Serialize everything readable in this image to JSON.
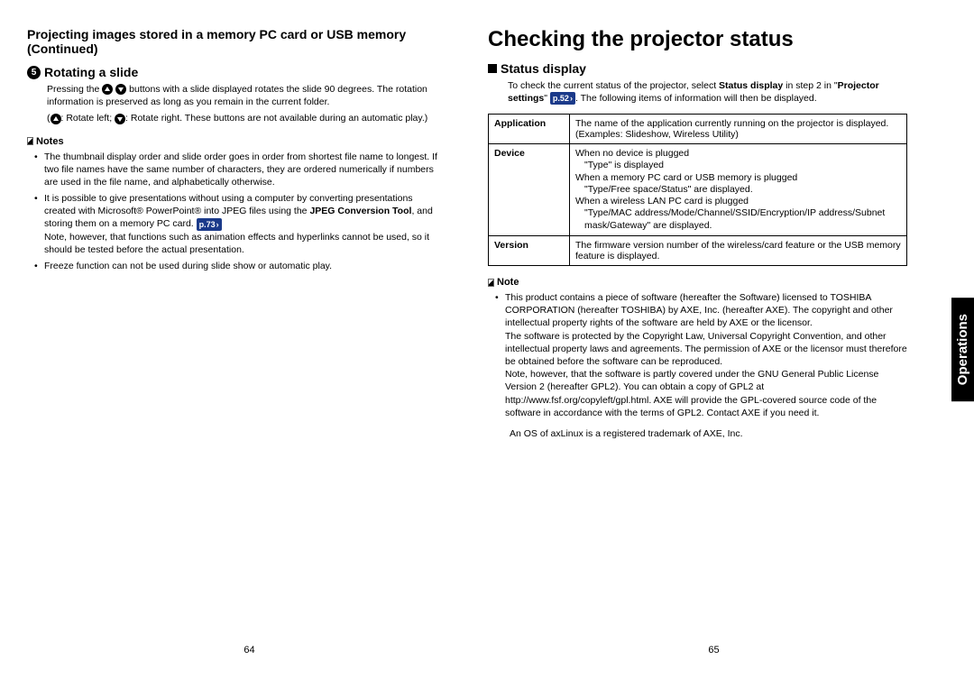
{
  "left": {
    "continued_header": "Projecting images stored in a memory PC card or USB memory (Continued)",
    "rotating": {
      "num": "5",
      "title": "Rotating a slide",
      "body1_a": "Pressing the ",
      "body1_b": " buttons with a slide displayed rotates the slide 90 degrees. The rotation information is preserved as long as you remain in the current folder.",
      "body2_a": ": Rotate left; ",
      "body2_b": ": Rotate right. These buttons are not available during an automatic play.)"
    },
    "notes_label": "Notes",
    "notes": [
      "The thumbnail display order and slide order goes in order from shortest file name to longest. If two file names have the same number of characters, they are ordered numerically if numbers are used in the file name, and alphabetically otherwise.",
      {
        "pre": "It is possible to give presentations without using a computer by converting presentations created with Microsoft® PowerPoint® into JPEG files using the ",
        "bold": "JPEG Conversion Tool",
        "post": ", and storing them on a memory PC card. ",
        "badge": "p.73",
        "tail": "\nNote, however, that functions such as animation effects and hyperlinks cannot be used, so it should be tested before the actual presentation."
      },
      "Freeze function can not be used during slide show or automatic play."
    ],
    "page_num": "64"
  },
  "right": {
    "title": "Checking the projector status",
    "status_display": "Status display",
    "intro_a": "To check the current status of the projector, select ",
    "intro_bold": "Status display",
    "intro_b": " in step 2 in \"",
    "intro_bold2": "Projector settings",
    "intro_c": "\" ",
    "badge": "p.52",
    "intro_d": ". The following items of information will then be displayed.",
    "table": {
      "r1h": "Application",
      "r1_a": "The name of the application currently running on the projector is displayed.",
      "r1_b": "(Examples: Slideshow, Wireless Utility)",
      "r2h": "Device",
      "r2_1": "When no device is plugged",
      "r2_1s": "\"Type\" is displayed",
      "r2_2": "When a memory PC card or USB memory is plugged",
      "r2_2s": "\"Type/Free space/Status\" are displayed.",
      "r2_3": "When a wireless LAN PC card is plugged",
      "r2_3s": "\"Type/MAC address/Mode/Channel/SSID/Encryption/IP address/Subnet mask/Gateway\" are displayed.",
      "r3h": "Version",
      "r3": "The firmware version number of the wireless/card feature or the USB memory feature is displayed."
    },
    "note_label": "Note",
    "note_body": "This product contains a piece of software (hereafter the Software) licensed to TOSHIBA CORPORATION (hereafter TOSHIBA) by AXE, Inc. (hereafter AXE). The copyright and other intellectual property rights of the software are held by AXE or the licensor.\nThe software is protected by the Copyright Law, Universal Copyright Convention, and other intellectual property laws and agreements. The permission of AXE or the licensor must therefore be obtained before the software can be reproduced.\nNote, however, that the software is partly covered under the GNU General Public License Version 2 (hereafter GPL2). You can obtain a copy of GPL2 at http://www.fsf.org/copyleft/gpl.html. AXE will provide the GPL-covered source code of the software in accordance with the terms of GPL2. Contact AXE if you need it.",
    "trademark": "An OS of axLinux is a registered trademark of AXE, Inc.",
    "page_num": "65",
    "side_tab": "Operations"
  }
}
